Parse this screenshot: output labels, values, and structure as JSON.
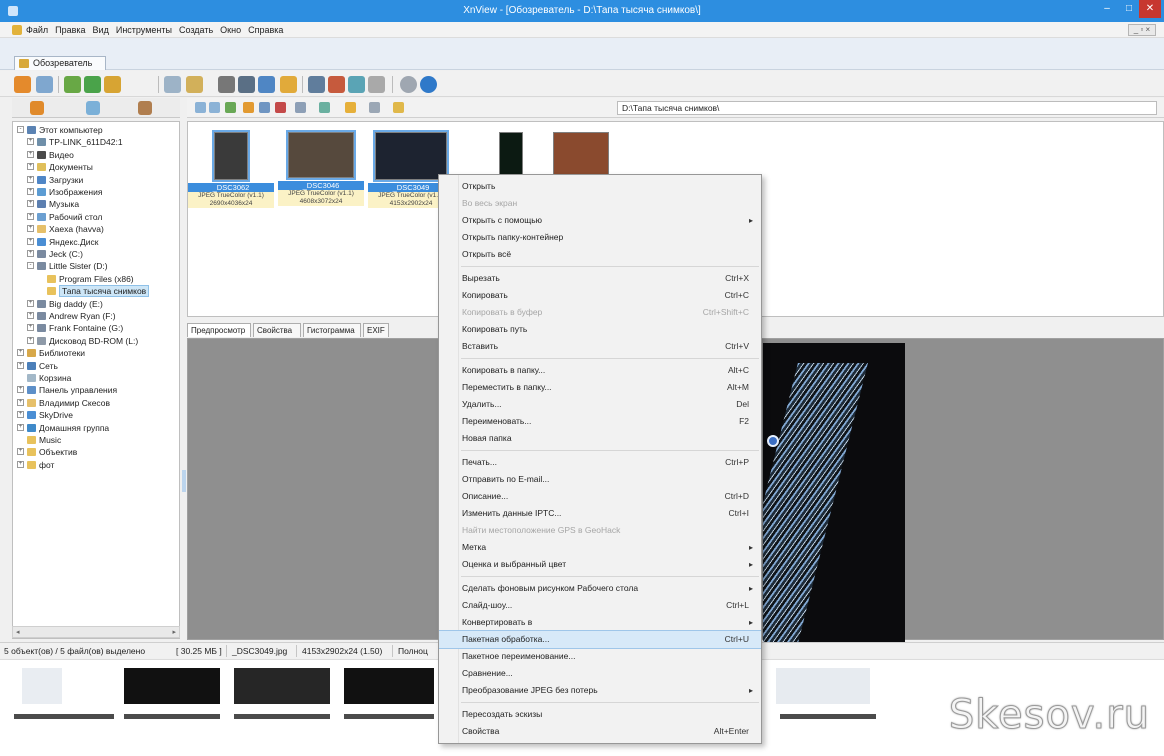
{
  "window": {
    "title": "XnView - [Обозреватель - D:\\Тапа тысяча снимков\\]",
    "minimize": "–",
    "maximize": "□",
    "close": "✕"
  },
  "menubar": {
    "items": [
      "Файл",
      "Правка",
      "Вид",
      "Инструменты",
      "Создать",
      "Окно",
      "Справка"
    ],
    "mdi": "_ ▫ ×"
  },
  "tabs": {
    "browse": "Обозреватель"
  },
  "address": {
    "path": "D:\\Тапа тысяча снимков\\"
  },
  "tree": [
    {
      "label": "Этот компьютер",
      "level": 0,
      "toggle": "-",
      "icon": "computer-icon"
    },
    {
      "label": "TP-LINK_611D42:1",
      "level": 1,
      "toggle": "+",
      "icon": "network-drive-icon"
    },
    {
      "label": "Видео",
      "level": 1,
      "toggle": "+",
      "icon": "video-folder-icon"
    },
    {
      "label": "Документы",
      "level": 1,
      "toggle": "+",
      "icon": "documents-folder-icon"
    },
    {
      "label": "Загрузки",
      "level": 1,
      "toggle": "+",
      "icon": "downloads-folder-icon"
    },
    {
      "label": "Изображения",
      "level": 1,
      "toggle": "+",
      "icon": "pictures-folder-icon"
    },
    {
      "label": "Музыка",
      "level": 1,
      "toggle": "+",
      "icon": "music-folder-icon"
    },
    {
      "label": "Рабочий стол",
      "level": 1,
      "toggle": "+",
      "icon": "desktop-folder-icon"
    },
    {
      "label": "Xaexa (havva)",
      "level": 1,
      "toggle": "+",
      "icon": "user-folder-icon"
    },
    {
      "label": "Яндекс.Диск",
      "level": 1,
      "toggle": "+",
      "icon": "cloud-drive-icon"
    },
    {
      "label": "Jeck (C:)",
      "level": 1,
      "toggle": "+",
      "icon": "hard-drive-icon"
    },
    {
      "label": "Little Sister (D:)",
      "level": 1,
      "toggle": "-",
      "icon": "hard-drive-icon"
    },
    {
      "label": "Program Files (x86)",
      "level": 2,
      "toggle": "",
      "icon": "folder-icon"
    },
    {
      "label": "Тапа тысяча снимков",
      "level": 2,
      "toggle": "",
      "icon": "folder-icon",
      "selected": true
    },
    {
      "label": "Big daddy (E:)",
      "level": 1,
      "toggle": "+",
      "icon": "hard-drive-icon"
    },
    {
      "label": "Andrew Ryan (F:)",
      "level": 1,
      "toggle": "+",
      "icon": "hard-drive-icon"
    },
    {
      "label": "Frank Fontaine (G:)",
      "level": 1,
      "toggle": "+",
      "icon": "hard-drive-icon"
    },
    {
      "label": "Дисковод BD-ROM (L:)",
      "level": 1,
      "toggle": "+",
      "icon": "optical-drive-icon"
    },
    {
      "label": "Библиотеки",
      "level": 0,
      "toggle": "+",
      "icon": "libraries-icon"
    },
    {
      "label": "Сеть",
      "level": 0,
      "toggle": "+",
      "icon": "network-icon"
    },
    {
      "label": "Корзина",
      "level": 0,
      "toggle": "",
      "icon": "recycle-bin-icon"
    },
    {
      "label": "Панель управления",
      "level": 0,
      "toggle": "+",
      "icon": "control-panel-icon"
    },
    {
      "label": "Владимир Скесов",
      "level": 0,
      "toggle": "+",
      "icon": "user-folder-icon"
    },
    {
      "label": "SkyDrive",
      "level": 0,
      "toggle": "+",
      "icon": "cloud-drive-icon"
    },
    {
      "label": "Домашняя группа",
      "level": 0,
      "toggle": "+",
      "icon": "homegroup-icon"
    },
    {
      "label": "Music",
      "level": 0,
      "toggle": "",
      "icon": "folder-icon"
    },
    {
      "label": "Объектив",
      "level": 0,
      "toggle": "+",
      "icon": "folder-icon"
    },
    {
      "label": "фот",
      "level": 0,
      "toggle": "+",
      "icon": "folder-icon"
    }
  ],
  "thumbnails": [
    {
      "name": "_DSC3062",
      "info1": "JPEG TrueColor (v1.1)",
      "info2": "2690x4036x24",
      "color": "#3a3a3a",
      "selected": true
    },
    {
      "name": "_DSC3046",
      "info1": "JPEG TrueColor (v1.1)",
      "info2": "4608x3072x24",
      "color": "#56493d",
      "selected": true
    },
    {
      "name": "_DSC3049",
      "info1": "JPEG TrueColor (v1.1)",
      "info2": "4153x2902x24",
      "color": "#1d2330",
      "selected": true
    },
    {
      "name": "",
      "info1": "",
      "info2": "",
      "color": "#0c1a12",
      "selected": false
    },
    {
      "name": "",
      "info1": "",
      "info2": "",
      "color": "#8a4a2e",
      "selected": false
    }
  ],
  "preview_tabs": [
    "Предпросмотр",
    "Свойства",
    "Гистограмма",
    "EXIF"
  ],
  "statusbar": {
    "selection": "5 объект(ов) / 5 файл(ов) выделено",
    "size": "[ 30.25 МБ ]",
    "file": "_DSC3049.jpg",
    "dims": "4153x2902x24 (1.50)",
    "mode": "Полноц"
  },
  "context_menu": [
    {
      "label": "Открыть",
      "shortcut": "",
      "arrow": false,
      "disabled": false,
      "hover": false
    },
    {
      "label": "Во весь экран",
      "shortcut": "",
      "arrow": false,
      "disabled": true,
      "hover": false
    },
    {
      "label": "Открыть с помощью",
      "shortcut": "",
      "arrow": true,
      "disabled": false,
      "hover": false
    },
    {
      "label": "Открыть папку-контейнер",
      "shortcut": "",
      "arrow": false,
      "disabled": false,
      "hover": false
    },
    {
      "label": "Открыть всё",
      "shortcut": "",
      "arrow": false,
      "disabled": false,
      "hover": false
    },
    {
      "sep": true
    },
    {
      "label": "Вырезать",
      "shortcut": "Ctrl+X",
      "arrow": false,
      "disabled": false,
      "hover": false
    },
    {
      "label": "Копировать",
      "shortcut": "Ctrl+C",
      "arrow": false,
      "disabled": false,
      "hover": false
    },
    {
      "label": "Копировать в буфер",
      "shortcut": "Ctrl+Shift+C",
      "arrow": false,
      "disabled": true,
      "hover": false
    },
    {
      "label": "Копировать путь",
      "shortcut": "",
      "arrow": false,
      "disabled": false,
      "hover": false
    },
    {
      "label": "Вставить",
      "shortcut": "Ctrl+V",
      "arrow": false,
      "disabled": false,
      "hover": false
    },
    {
      "sep": true
    },
    {
      "label": "Копировать в папку...",
      "shortcut": "Alt+C",
      "arrow": false,
      "disabled": false,
      "hover": false
    },
    {
      "label": "Переместить в папку...",
      "shortcut": "Alt+M",
      "arrow": false,
      "disabled": false,
      "hover": false
    },
    {
      "label": "Удалить...",
      "shortcut": "Del",
      "arrow": false,
      "disabled": false,
      "hover": false
    },
    {
      "label": "Переименовать...",
      "shortcut": "F2",
      "arrow": false,
      "disabled": false,
      "hover": false
    },
    {
      "label": "Новая папка",
      "shortcut": "",
      "arrow": false,
      "disabled": false,
      "hover": false
    },
    {
      "sep": true
    },
    {
      "label": "Печать...",
      "shortcut": "Ctrl+P",
      "arrow": false,
      "disabled": false,
      "hover": false
    },
    {
      "label": "Отправить по E-mail...",
      "shortcut": "",
      "arrow": false,
      "disabled": false,
      "hover": false
    },
    {
      "label": "Описание...",
      "shortcut": "Ctrl+D",
      "arrow": false,
      "disabled": false,
      "hover": false
    },
    {
      "label": "Изменить данные IPTC...",
      "shortcut": "Ctrl+I",
      "arrow": false,
      "disabled": false,
      "hover": false
    },
    {
      "label": "Найти местоположение GPS в GeoHack",
      "shortcut": "",
      "arrow": false,
      "disabled": true,
      "hover": false
    },
    {
      "label": "Метка",
      "shortcut": "",
      "arrow": true,
      "disabled": false,
      "hover": false
    },
    {
      "label": "Оценка и выбранный цвет",
      "shortcut": "",
      "arrow": true,
      "disabled": false,
      "hover": false
    },
    {
      "sep": true
    },
    {
      "label": "Сделать фоновым рисунком Рабочего стола",
      "shortcut": "",
      "arrow": true,
      "disabled": false,
      "hover": false
    },
    {
      "label": "Слайд-шоу...",
      "shortcut": "Ctrl+L",
      "arrow": false,
      "disabled": false,
      "hover": false
    },
    {
      "label": "Конвертировать в",
      "shortcut": "",
      "arrow": true,
      "disabled": false,
      "hover": false
    },
    {
      "label": "Пакетная обработка...",
      "shortcut": "Ctrl+U",
      "arrow": false,
      "disabled": false,
      "hover": true
    },
    {
      "label": "Пакетное переименование...",
      "shortcut": "",
      "arrow": false,
      "disabled": false,
      "hover": false
    },
    {
      "label": "Сравнение...",
      "shortcut": "",
      "arrow": false,
      "disabled": false,
      "hover": false
    },
    {
      "label": "Преобразование JPEG без потерь",
      "shortcut": "",
      "arrow": true,
      "disabled": false,
      "hover": false
    },
    {
      "sep": true
    },
    {
      "label": "Пересоздать эскизы",
      "shortcut": "",
      "arrow": false,
      "disabled": false,
      "hover": false
    },
    {
      "label": "Свойства",
      "shortcut": "Alt+Enter",
      "arrow": false,
      "disabled": false,
      "hover": false
    }
  ],
  "watermark": "Skesov.ru",
  "colors": {
    "titlebar": "#2d8ee0",
    "selection": "#3b8ddd",
    "menu_hover": "#d7e9f8"
  }
}
